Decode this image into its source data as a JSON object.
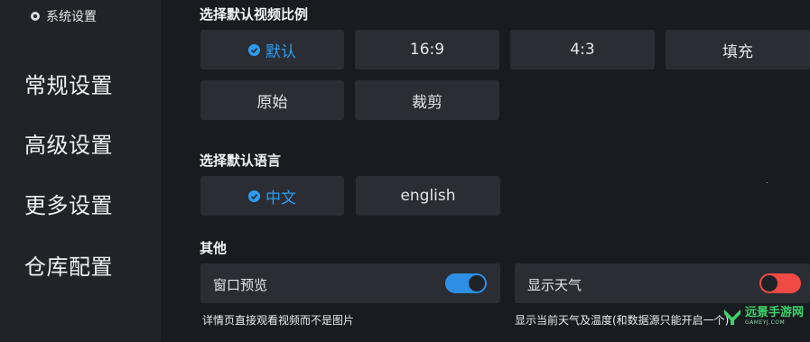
{
  "sidebar": {
    "title": "系统设置",
    "title_icon": "gear-icon",
    "items": [
      {
        "label": "常规设置"
      },
      {
        "label": "高级设置"
      },
      {
        "label": "更多设置"
      },
      {
        "label": "仓库配置"
      }
    ]
  },
  "aspect": {
    "title": "选择默认视频比例",
    "options": [
      {
        "label": "默认",
        "selected": true
      },
      {
        "label": "16:9"
      },
      {
        "label": "4:3"
      },
      {
        "label": "填充"
      },
      {
        "label": "原始"
      },
      {
        "label": "裁剪"
      }
    ]
  },
  "language": {
    "title": "选择默认语言",
    "options": [
      {
        "label": "中文",
        "selected": true
      },
      {
        "label": "english"
      }
    ]
  },
  "other": {
    "title": "其他",
    "preview": {
      "label": "窗口预览",
      "enabled": true,
      "desc": "详情页直接观看视频而不是图片"
    },
    "weather": {
      "label": "显示天气",
      "enabled": false,
      "desc": "显示当前天气及温度(和数据源只能开启一个)"
    }
  },
  "colors": {
    "accent": "#2d9cf0",
    "toggle_on": "#2d8fe6",
    "toggle_off": "#ef4a43",
    "watermark": "#3fd36a"
  },
  "watermark": {
    "main": "远景手游网",
    "sub": "GAMEYJ.COM"
  }
}
